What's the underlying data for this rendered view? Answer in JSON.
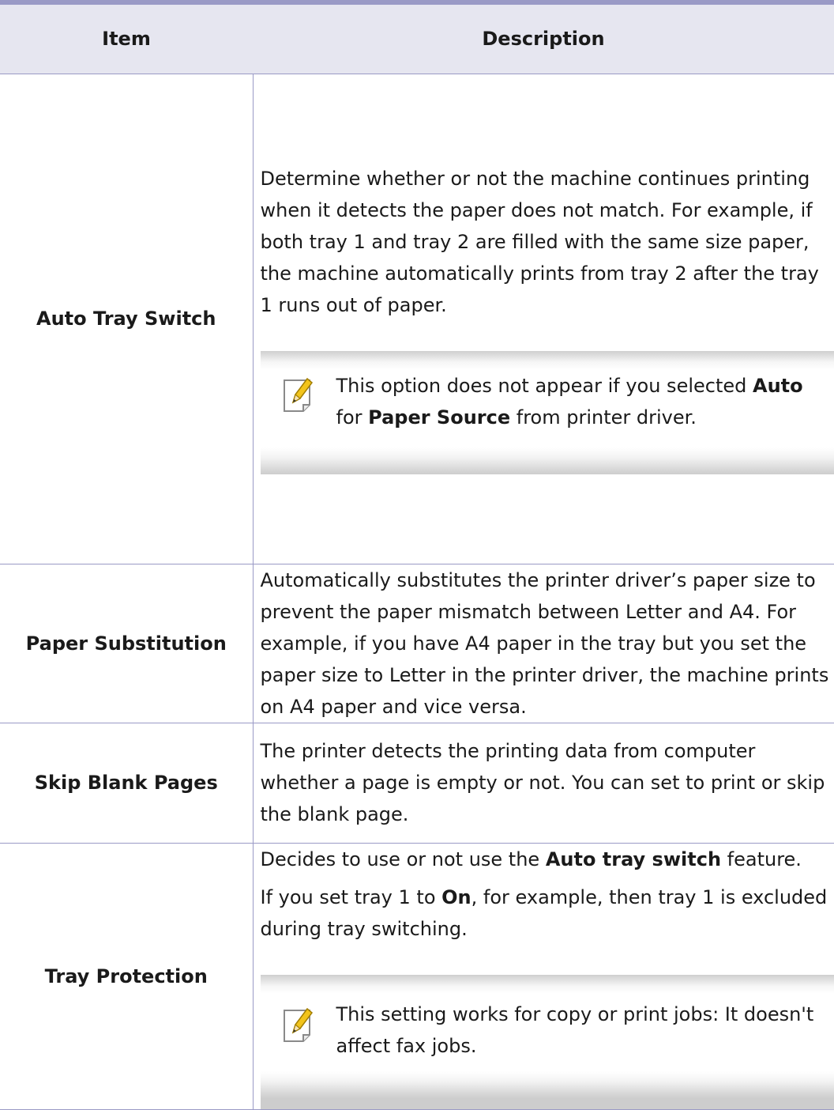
{
  "table": {
    "headers": {
      "item": "Item",
      "description": "Description"
    },
    "rows": [
      {
        "item": "Auto Tray Switch",
        "description": "Determine whether or not the machine continues printing when it detects the paper does not match. For example, if both tray 1 and tray 2 are filled with the same size paper, the machine automatically prints from tray 2 after the tray 1 runs out of paper.",
        "note": {
          "icon": "note-pencil-icon",
          "text_1": "This option does not appear if you selected ",
          "bold_1": "Auto",
          "text_2": " for ",
          "bold_2": "Paper Source",
          "text_3": " from printer driver."
        }
      },
      {
        "item": "Paper Substitution",
        "description": "Automatically substitutes the printer driver’s paper size to prevent the paper mismatch between Letter and A4. For example, if you have A4 paper in the tray but you set the paper size to Letter in the printer driver, the machine prints on A4 paper and vice versa."
      },
      {
        "item": "Skip Blank Pages",
        "description": "The printer detects the printing data from computer whether a page is empty or not. You can set to print or skip the blank page."
      },
      {
        "item": "Tray Protection",
        "para_1": {
          "text_1": "Decides to use or not use the ",
          "bold_1": "Auto tray switch",
          "text_2": " feature."
        },
        "para_2": {
          "text_1": " If you set tray 1 to ",
          "bold_1": "On",
          "text_2": ", for example, then tray 1 is excluded during tray switching."
        },
        "note": {
          "icon": "note-pencil-icon",
          "text": " This setting works for copy or print jobs: It doesn't affect fax jobs."
        }
      }
    ]
  },
  "colors": {
    "header_background": "#e6e6f0",
    "rule": "#9a9ac6",
    "text": "#1a1a1a"
  }
}
